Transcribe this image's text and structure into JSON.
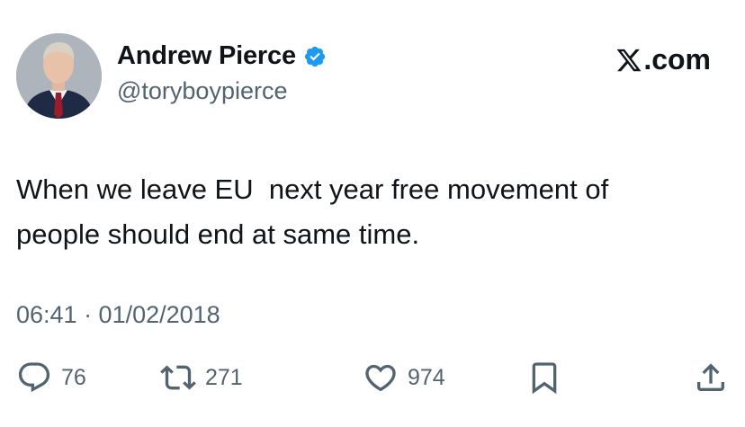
{
  "author": {
    "display_name": "Andrew Pierce",
    "handle": "@toryboypierce",
    "verified": true
  },
  "brand": {
    "label": ".com",
    "icon": "x-logo-icon"
  },
  "tweet": {
    "text": "When we leave EU  next year free movement of\npeople should end at same time.",
    "timestamp": "06:41 · 01/02/2018"
  },
  "actions": {
    "replies": "76",
    "retweets": "271",
    "likes": "974"
  },
  "colors": {
    "text": "#0f1419",
    "secondary": "#536471",
    "verified": "#1d9bf0"
  }
}
